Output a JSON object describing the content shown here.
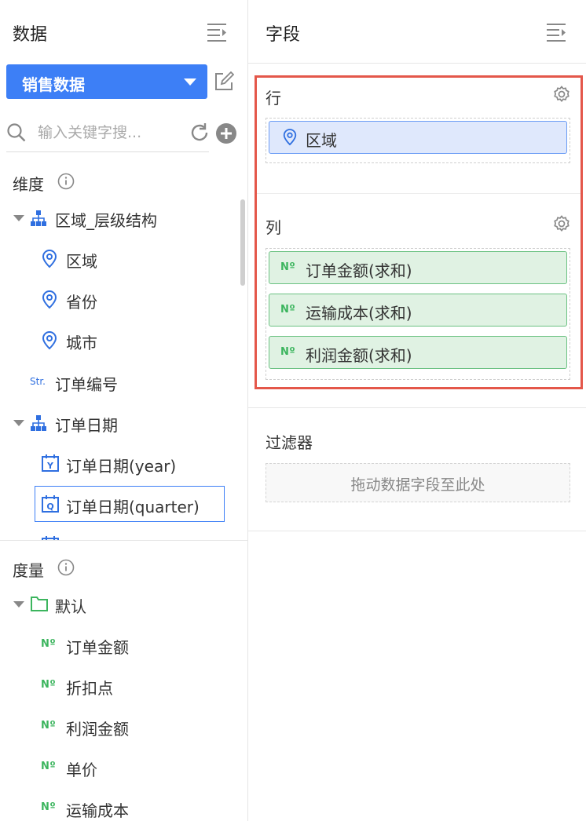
{
  "left_panel": {
    "title": "数据",
    "dataset": {
      "name": "销售数据"
    },
    "search": {
      "placeholder": "输入关键字搜..."
    },
    "dimensions": {
      "title": "维度",
      "items": [
        {
          "label": "区域_层级结构",
          "icon": "hierarchy-icon",
          "expanded": true
        },
        {
          "label": "区域",
          "icon": "location-icon"
        },
        {
          "label": "省份",
          "icon": "location-icon"
        },
        {
          "label": "城市",
          "icon": "location-icon"
        },
        {
          "label": "订单编号",
          "icon": "string-icon",
          "tag": "Str."
        },
        {
          "label": "订单日期",
          "icon": "hierarchy-icon",
          "expanded": true
        },
        {
          "label": "订单日期(year)",
          "icon": "date-year-icon",
          "tag": "Y"
        },
        {
          "label": "订单日期(quarter)",
          "icon": "date-quarter-icon",
          "tag": "Q",
          "selected": true
        }
      ]
    },
    "measures": {
      "title": "度量",
      "folder": "默认",
      "tag": "Nº",
      "items": [
        {
          "label": "订单金额"
        },
        {
          "label": "折扣点"
        },
        {
          "label": "利润金额"
        },
        {
          "label": "单价"
        },
        {
          "label": "运输成本"
        }
      ]
    }
  },
  "right_panel": {
    "title": "字段",
    "rows": {
      "label": "行",
      "fields": [
        {
          "label": "区域",
          "icon": "location-icon"
        }
      ]
    },
    "columns": {
      "label": "列",
      "fields": [
        {
          "label": "订单金额(求和)",
          "tag": "Nº"
        },
        {
          "label": "运输成本(求和)",
          "tag": "Nº"
        },
        {
          "label": "利润金额(求和)",
          "tag": "Nº"
        }
      ]
    },
    "filter": {
      "label": "过滤器",
      "placeholder": "拖动数据字段至此处"
    }
  },
  "colors": {
    "accent": "#3d7ff6",
    "measure_green": "#3cb55e",
    "highlight_red": "#e4574a",
    "dimension_pill": "#dfe8fc",
    "measure_pill": "#e0f2e3"
  }
}
